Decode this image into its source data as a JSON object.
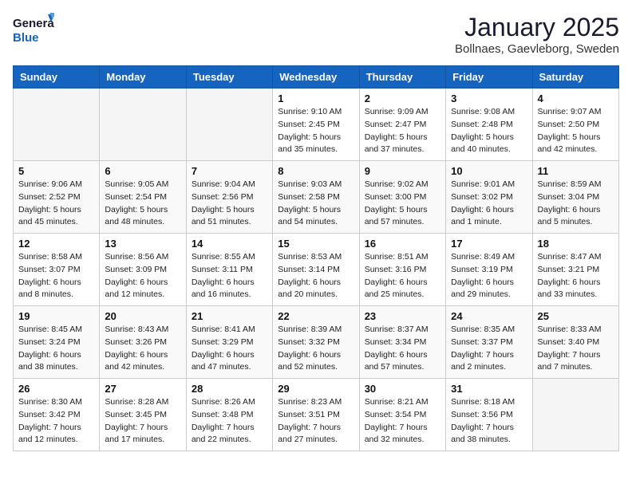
{
  "header": {
    "logo_general": "General",
    "logo_blue": "Blue",
    "month_year": "January 2025",
    "location": "Bollnaes, Gaevleborg, Sweden"
  },
  "calendar": {
    "days_of_week": [
      "Sunday",
      "Monday",
      "Tuesday",
      "Wednesday",
      "Thursday",
      "Friday",
      "Saturday"
    ],
    "weeks": [
      [
        {
          "day": "",
          "info": ""
        },
        {
          "day": "",
          "info": ""
        },
        {
          "day": "",
          "info": ""
        },
        {
          "day": "1",
          "info": "Sunrise: 9:10 AM\nSunset: 2:45 PM\nDaylight: 5 hours\nand 35 minutes."
        },
        {
          "day": "2",
          "info": "Sunrise: 9:09 AM\nSunset: 2:47 PM\nDaylight: 5 hours\nand 37 minutes."
        },
        {
          "day": "3",
          "info": "Sunrise: 9:08 AM\nSunset: 2:48 PM\nDaylight: 5 hours\nand 40 minutes."
        },
        {
          "day": "4",
          "info": "Sunrise: 9:07 AM\nSunset: 2:50 PM\nDaylight: 5 hours\nand 42 minutes."
        }
      ],
      [
        {
          "day": "5",
          "info": "Sunrise: 9:06 AM\nSunset: 2:52 PM\nDaylight: 5 hours\nand 45 minutes."
        },
        {
          "day": "6",
          "info": "Sunrise: 9:05 AM\nSunset: 2:54 PM\nDaylight: 5 hours\nand 48 minutes."
        },
        {
          "day": "7",
          "info": "Sunrise: 9:04 AM\nSunset: 2:56 PM\nDaylight: 5 hours\nand 51 minutes."
        },
        {
          "day": "8",
          "info": "Sunrise: 9:03 AM\nSunset: 2:58 PM\nDaylight: 5 hours\nand 54 minutes."
        },
        {
          "day": "9",
          "info": "Sunrise: 9:02 AM\nSunset: 3:00 PM\nDaylight: 5 hours\nand 57 minutes."
        },
        {
          "day": "10",
          "info": "Sunrise: 9:01 AM\nSunset: 3:02 PM\nDaylight: 6 hours\nand 1 minute."
        },
        {
          "day": "11",
          "info": "Sunrise: 8:59 AM\nSunset: 3:04 PM\nDaylight: 6 hours\nand 5 minutes."
        }
      ],
      [
        {
          "day": "12",
          "info": "Sunrise: 8:58 AM\nSunset: 3:07 PM\nDaylight: 6 hours\nand 8 minutes."
        },
        {
          "day": "13",
          "info": "Sunrise: 8:56 AM\nSunset: 3:09 PM\nDaylight: 6 hours\nand 12 minutes."
        },
        {
          "day": "14",
          "info": "Sunrise: 8:55 AM\nSunset: 3:11 PM\nDaylight: 6 hours\nand 16 minutes."
        },
        {
          "day": "15",
          "info": "Sunrise: 8:53 AM\nSunset: 3:14 PM\nDaylight: 6 hours\nand 20 minutes."
        },
        {
          "day": "16",
          "info": "Sunrise: 8:51 AM\nSunset: 3:16 PM\nDaylight: 6 hours\nand 25 minutes."
        },
        {
          "day": "17",
          "info": "Sunrise: 8:49 AM\nSunset: 3:19 PM\nDaylight: 6 hours\nand 29 minutes."
        },
        {
          "day": "18",
          "info": "Sunrise: 8:47 AM\nSunset: 3:21 PM\nDaylight: 6 hours\nand 33 minutes."
        }
      ],
      [
        {
          "day": "19",
          "info": "Sunrise: 8:45 AM\nSunset: 3:24 PM\nDaylight: 6 hours\nand 38 minutes."
        },
        {
          "day": "20",
          "info": "Sunrise: 8:43 AM\nSunset: 3:26 PM\nDaylight: 6 hours\nand 42 minutes."
        },
        {
          "day": "21",
          "info": "Sunrise: 8:41 AM\nSunset: 3:29 PM\nDaylight: 6 hours\nand 47 minutes."
        },
        {
          "day": "22",
          "info": "Sunrise: 8:39 AM\nSunset: 3:32 PM\nDaylight: 6 hours\nand 52 minutes."
        },
        {
          "day": "23",
          "info": "Sunrise: 8:37 AM\nSunset: 3:34 PM\nDaylight: 6 hours\nand 57 minutes."
        },
        {
          "day": "24",
          "info": "Sunrise: 8:35 AM\nSunset: 3:37 PM\nDaylight: 7 hours\nand 2 minutes."
        },
        {
          "day": "25",
          "info": "Sunrise: 8:33 AM\nSunset: 3:40 PM\nDaylight: 7 hours\nand 7 minutes."
        }
      ],
      [
        {
          "day": "26",
          "info": "Sunrise: 8:30 AM\nSunset: 3:42 PM\nDaylight: 7 hours\nand 12 minutes."
        },
        {
          "day": "27",
          "info": "Sunrise: 8:28 AM\nSunset: 3:45 PM\nDaylight: 7 hours\nand 17 minutes."
        },
        {
          "day": "28",
          "info": "Sunrise: 8:26 AM\nSunset: 3:48 PM\nDaylight: 7 hours\nand 22 minutes."
        },
        {
          "day": "29",
          "info": "Sunrise: 8:23 AM\nSunset: 3:51 PM\nDaylight: 7 hours\nand 27 minutes."
        },
        {
          "day": "30",
          "info": "Sunrise: 8:21 AM\nSunset: 3:54 PM\nDaylight: 7 hours\nand 32 minutes."
        },
        {
          "day": "31",
          "info": "Sunrise: 8:18 AM\nSunset: 3:56 PM\nDaylight: 7 hours\nand 38 minutes."
        },
        {
          "day": "",
          "info": ""
        }
      ]
    ]
  }
}
